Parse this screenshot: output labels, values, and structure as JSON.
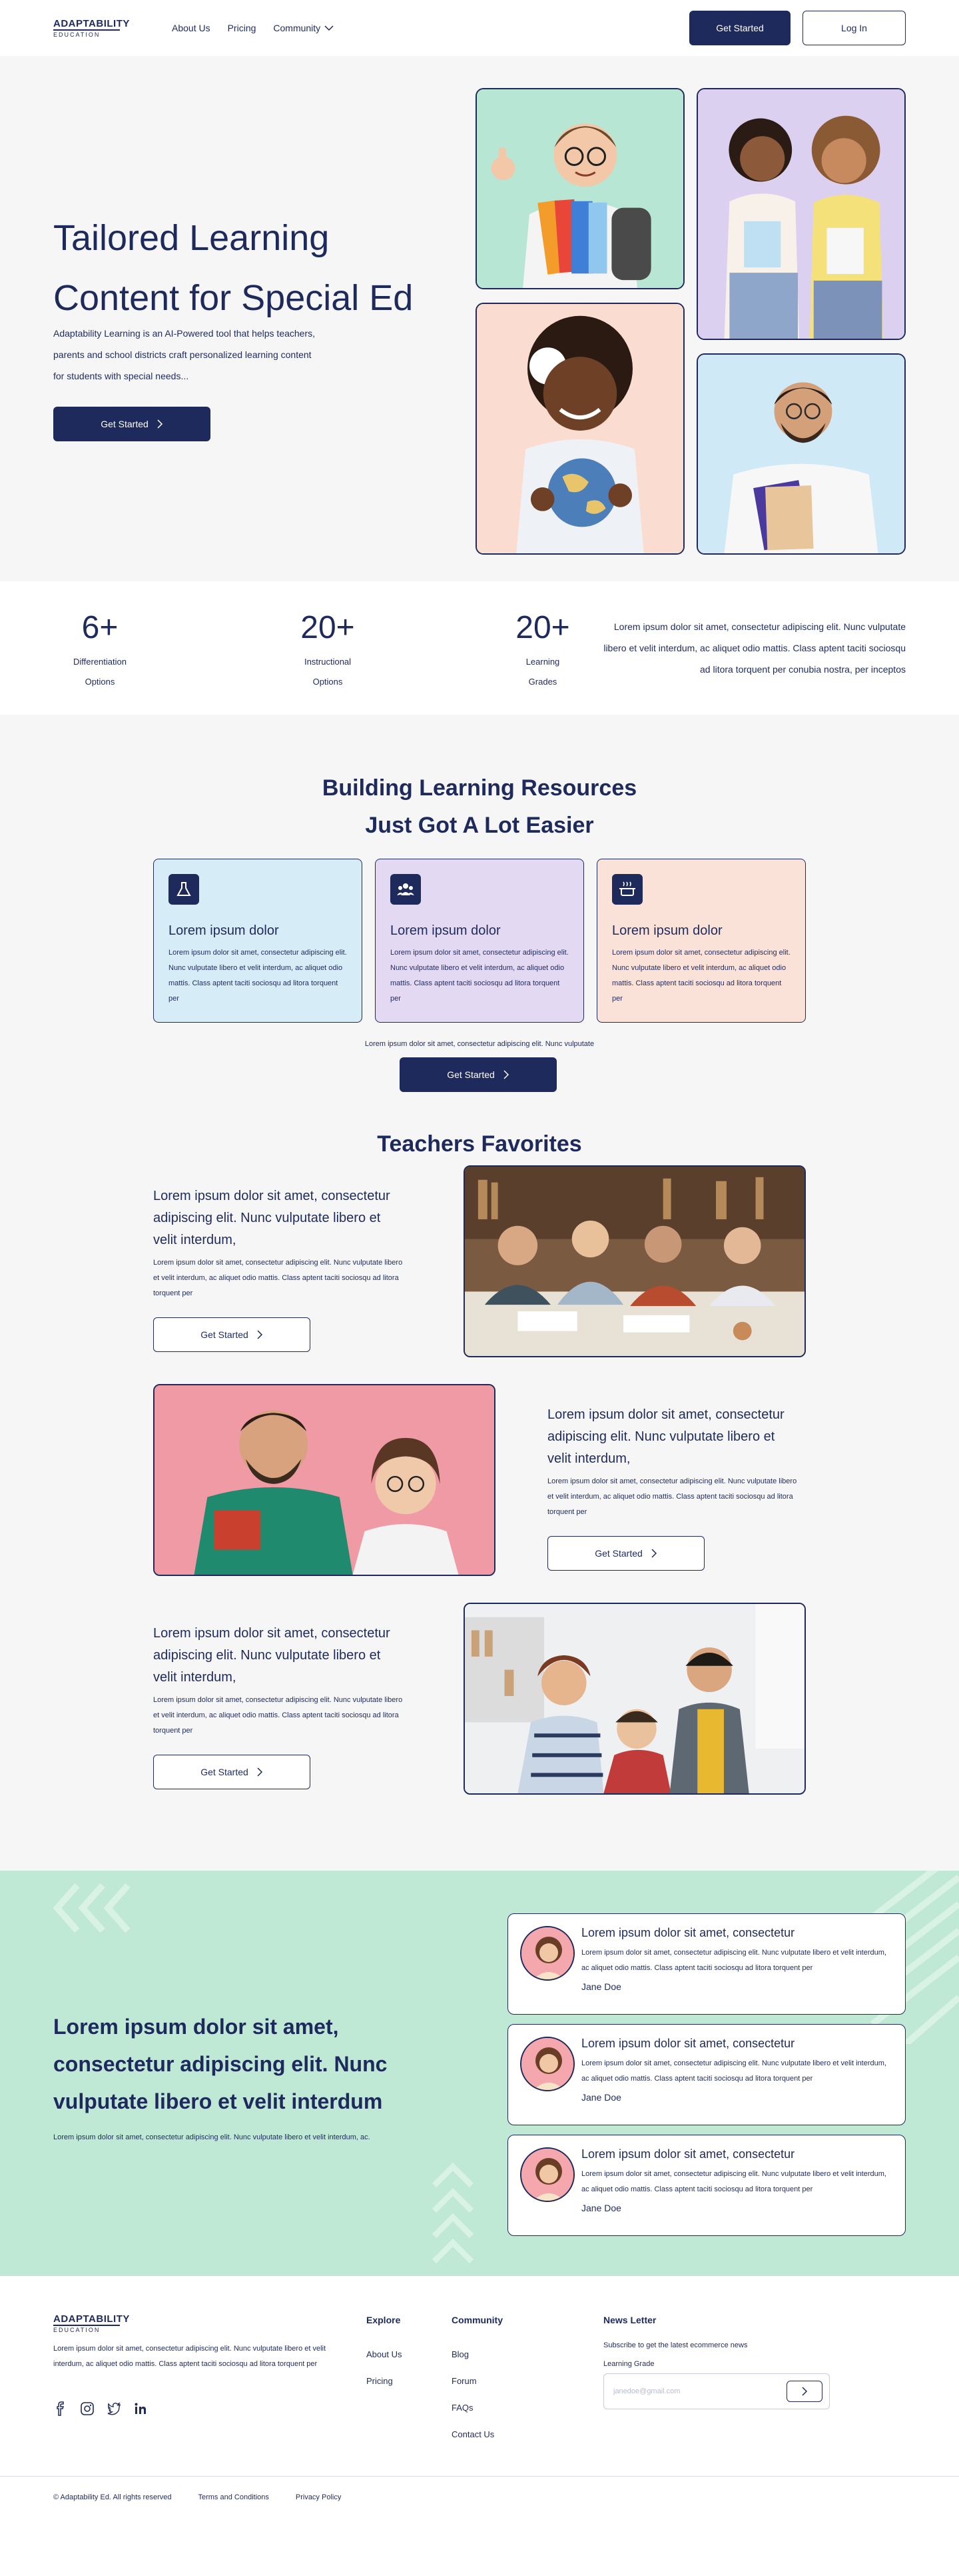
{
  "nav": {
    "logo_top": "ADAPTABILITY",
    "logo_bottom": "EDUCATION",
    "links": [
      "About Us",
      "Pricing",
      "Community"
    ],
    "get_started": "Get Started",
    "log_in": "Log In"
  },
  "hero": {
    "title_line1": "Tailored Learning",
    "title_line2": "Content for Special Ed",
    "desc": "Adaptability Learning is an AI-Powered tool that helps teachers, parents and school districts craft personalized learning content for students with special needs...",
    "button": "Get Started"
  },
  "stats": {
    "items": [
      {
        "num": "6+",
        "label_1": "Differentiation",
        "label_2": "Options"
      },
      {
        "num": "20+",
        "label_1": "Instructional",
        "label_2": "Options"
      },
      {
        "num": "20+",
        "label_1": "Learning",
        "label_2": "Grades"
      }
    ],
    "text": "Lorem ipsum dolor sit amet, consectetur adipiscing elit. Nunc vulputate libero et velit interdum, ac aliquet odio mattis. Class aptent taciti sociosqu ad litora torquent per conubia nostra, per inceptos"
  },
  "resources": {
    "title_line1": "Building Learning Resources",
    "title_line2": "Just Got A Lot Easier",
    "cards": [
      {
        "title": "Lorem ipsum dolor",
        "text": "Lorem ipsum dolor sit amet, consectetur adipiscing elit. Nunc vulputate libero et velit interdum, ac aliquet odio mattis. Class aptent taciti sociosqu ad litora torquent per",
        "bg": "#d6ecf6",
        "icon": "flask-icon"
      },
      {
        "title": "Lorem ipsum dolor",
        "text": "Lorem ipsum dolor sit amet, consectetur adipiscing elit. Nunc vulputate libero et velit interdum, ac aliquet odio mattis. Class aptent taciti sociosqu ad litora torquent per",
        "bg": "#e3d9f3",
        "icon": "people-icon"
      },
      {
        "title": "Lorem ipsum dolor",
        "text": "Lorem ipsum dolor sit amet, consectetur adipiscing elit. Nunc vulputate libero et velit interdum, ac aliquet odio mattis. Class aptent taciti sociosqu ad litora torquent per",
        "bg": "#fbe2d9",
        "icon": "cooking-pot-icon"
      }
    ],
    "small_text": "Lorem ipsum dolor sit amet, consectetur adipiscing elit. Nunc vulputate",
    "button": "Get Started"
  },
  "favorites": {
    "title": "Teachers Favorites",
    "items": [
      {
        "heading": "Lorem ipsum dolor sit amet, consectetur adipiscing elit. Nunc vulputate libero et velit interdum,",
        "text": "Lorem ipsum dolor sit amet, consectetur adipiscing elit. Nunc vulputate libero et velit interdum, ac aliquet odio mattis. Class aptent taciti sociosqu ad litora torquent per",
        "button": "Get Started"
      },
      {
        "heading": "Lorem ipsum dolor sit amet, consectetur adipiscing elit. Nunc vulputate libero et velit interdum,",
        "text": "Lorem ipsum dolor sit amet, consectetur adipiscing elit. Nunc vulputate libero et velit interdum, ac aliquet odio mattis. Class aptent taciti sociosqu ad litora torquent per",
        "button": "Get Started"
      },
      {
        "heading": "Lorem ipsum dolor sit amet, consectetur adipiscing elit. Nunc vulputate libero et velit interdum,",
        "text": "Lorem ipsum dolor sit amet, consectetur adipiscing elit. Nunc vulputate libero et velit interdum, ac aliquet odio mattis. Class aptent taciti sociosqu ad litora torquent per",
        "button": "Get Started"
      }
    ]
  },
  "testimonials": {
    "heading": "Lorem ipsum dolor sit amet, consectetur adipiscing elit. Nunc vulputate libero et velit interdum",
    "small": "Lorem ipsum dolor sit amet, consectetur adipiscing elit. Nunc vulputate libero et velit interdum, ac.",
    "cards": [
      {
        "title": "Lorem ipsum dolor sit amet, consectetur",
        "text": "Lorem ipsum dolor sit amet, consectetur adipiscing elit. Nunc vulputate libero et velit interdum, ac aliquet odio mattis. Class aptent taciti sociosqu ad litora torquent per",
        "name": "Jane Doe"
      },
      {
        "title": "Lorem ipsum dolor sit amet, consectetur",
        "text": "Lorem ipsum dolor sit amet, consectetur adipiscing elit. Nunc vulputate libero et velit interdum, ac aliquet odio mattis. Class aptent taciti sociosqu ad litora torquent per",
        "name": "Jane Doe"
      },
      {
        "title": "Lorem ipsum dolor sit amet, consectetur",
        "text": "Lorem ipsum dolor sit amet, consectetur adipiscing elit. Nunc vulputate libero et velit interdum, ac aliquet odio mattis. Class aptent taciti sociosqu ad litora torquent per",
        "name": "Jane Doe"
      }
    ]
  },
  "footer": {
    "desc": "Lorem ipsum dolor sit amet, consectetur adipiscing elit. Nunc vulputate libero et velit interdum, ac aliquet odio mattis. Class aptent taciti sociosqu ad litora torquent per",
    "explore": {
      "heading": "Explore",
      "items": [
        "About Us",
        "Pricing"
      ]
    },
    "community": {
      "heading": "Community",
      "items": [
        "Blog",
        "Forum",
        "FAQs",
        "Contact Us"
      ]
    },
    "newsletter": {
      "heading": "News Letter",
      "sub": "Subscribe to get the latest ecommerce news",
      "label": "Learning Grade",
      "placeholder": "janedoe@gmail.com"
    },
    "copyright": "© Adaptability Ed. All rights reserved",
    "terms": "Terms and Conditions",
    "privacy": "Privacy Policy"
  },
  "colors": {
    "navy": "#1f2a5c",
    "hero_bg": "#f6f6f7",
    "mint": "#bfe8d5"
  }
}
